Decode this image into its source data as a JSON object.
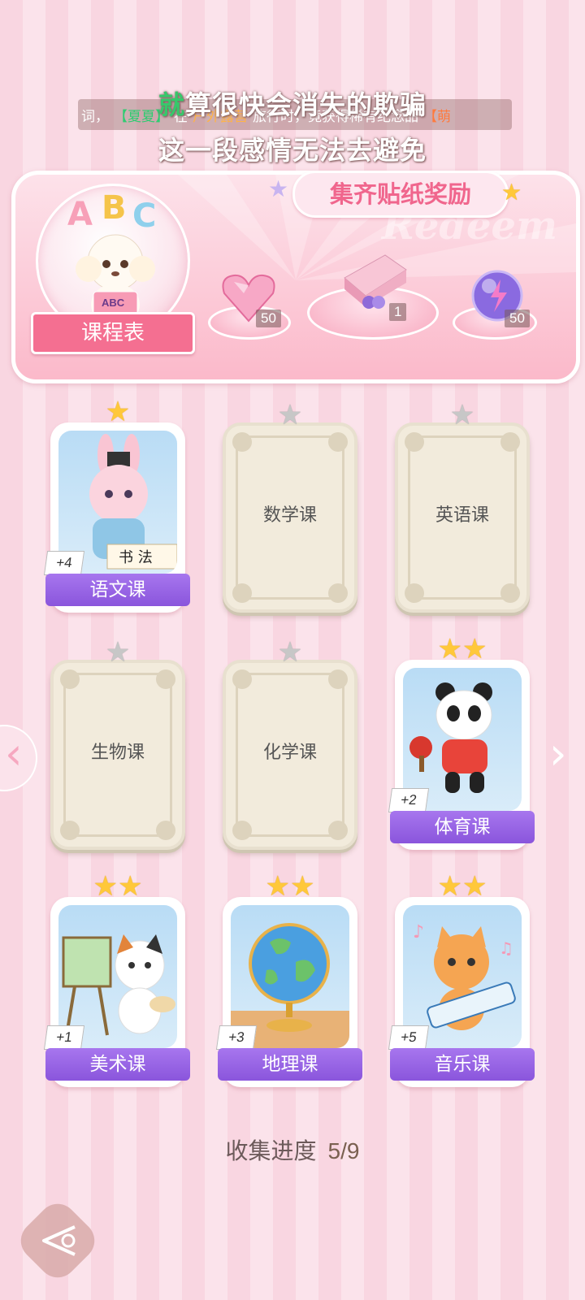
{
  "ticker": {
    "prefix": "词，",
    "name": "【夏夏",
    "name_close": "】",
    "text1": "在",
    "place": "户外露营",
    "text2": "旅行时，竟获得稀有纪念品",
    "tail": "【萌"
  },
  "lyrics": {
    "line1_first": "就",
    "line1_rest": "算很快会消失的欺骗",
    "line2": "这一段感情无法去避免"
  },
  "banner": {
    "title": "集齐贴纸奖励",
    "watermark": "Redeem",
    "schedule_label": "课程表",
    "abc": [
      "A",
      "B",
      "C"
    ],
    "book_text": "ABC",
    "rewards": [
      {
        "name": "heart-gem",
        "count": "50"
      },
      {
        "name": "gift-box",
        "count": "1"
      },
      {
        "name": "energy-orb",
        "count": "50"
      }
    ]
  },
  "cards": [
    {
      "subject": "语文课",
      "stars": 1,
      "unlocked": true,
      "bonus": "+4"
    },
    {
      "subject": "数学课",
      "stars": 1,
      "unlocked": false
    },
    {
      "subject": "英语课",
      "stars": 1,
      "unlocked": false
    },
    {
      "subject": "生物课",
      "stars": 1,
      "unlocked": false
    },
    {
      "subject": "化学课",
      "stars": 1,
      "unlocked": false
    },
    {
      "subject": "体育课",
      "stars": 2,
      "unlocked": true,
      "bonus": "+2"
    },
    {
      "subject": "美术课",
      "stars": 2,
      "unlocked": true,
      "bonus": "+1"
    },
    {
      "subject": "地理课",
      "stars": 2,
      "unlocked": true,
      "bonus": "+3"
    },
    {
      "subject": "音乐课",
      "stars": 2,
      "unlocked": true,
      "bonus": "+5"
    }
  ],
  "progress": {
    "label": "收集进度",
    "value": "5/9"
  },
  "colors": {
    "accent": "#f46f91",
    "ribbon": "#8a55dc",
    "star": "#ffc83a"
  }
}
